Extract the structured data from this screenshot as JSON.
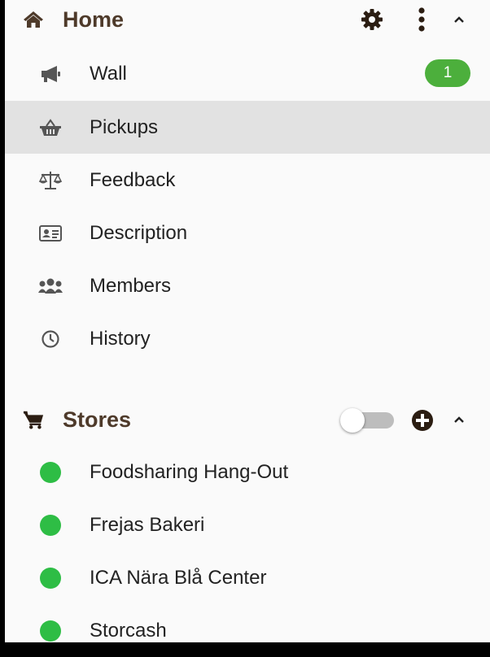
{
  "home": {
    "title": "Home",
    "icon": "home-icon",
    "actions": [
      "gear-icon",
      "more-vertical-icon",
      "chevron-up-icon"
    ],
    "items": [
      {
        "label": "Wall",
        "icon": "megaphone-icon",
        "badge": "1"
      },
      {
        "label": "Pickups",
        "icon": "basket-icon",
        "active": true
      },
      {
        "label": "Feedback",
        "icon": "balance-scale-icon"
      },
      {
        "label": "Description",
        "icon": "id-card-icon"
      },
      {
        "label": "Members",
        "icon": "users-icon"
      },
      {
        "label": "History",
        "icon": "clock-icon"
      }
    ]
  },
  "stores": {
    "title": "Stores",
    "icon": "cart-icon",
    "toggle_on": false,
    "actions": [
      "plus-circle-icon",
      "chevron-up-icon"
    ],
    "items": [
      {
        "label": "Foodsharing Hang-Out",
        "status_color": "#2ebd45"
      },
      {
        "label": "Frejas Bakeri",
        "status_color": "#2ebd45"
      },
      {
        "label": "ICA Nära Blå Center",
        "status_color": "#2ebd45"
      },
      {
        "label": "Storcash",
        "status_color": "#2ebd45"
      }
    ]
  },
  "colors": {
    "header_text": "#4e3a2a",
    "badge": "#4caf3c",
    "active_row": "#e2e2e2",
    "status_dot": "#2ebd45"
  }
}
